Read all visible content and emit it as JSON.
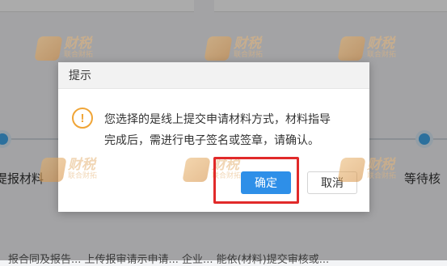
{
  "background": {
    "steps": [
      {
        "label": "提报材料"
      },
      {
        "label": "等待核"
      }
    ],
    "bottom_text": "报合同及报告... 上传报审请示申请... 企业... 能依(材料)提交审核或..."
  },
  "watermark": {
    "brand": "财税",
    "sub": "联合财拓"
  },
  "dialog": {
    "title": "提示",
    "warning_icon": "exclamation-icon",
    "message_line1": "您选择的是线上提交申请材料方式，材料指导",
    "message_line2": "完成后，需进行电子签名或签章，请确认。",
    "confirm_label": "确定",
    "cancel_label": "取消"
  },
  "colors": {
    "primary": "#2e8fe8",
    "warning": "#f0a537",
    "highlight": "#e12a2a",
    "step_dot": "#40a7ea"
  }
}
